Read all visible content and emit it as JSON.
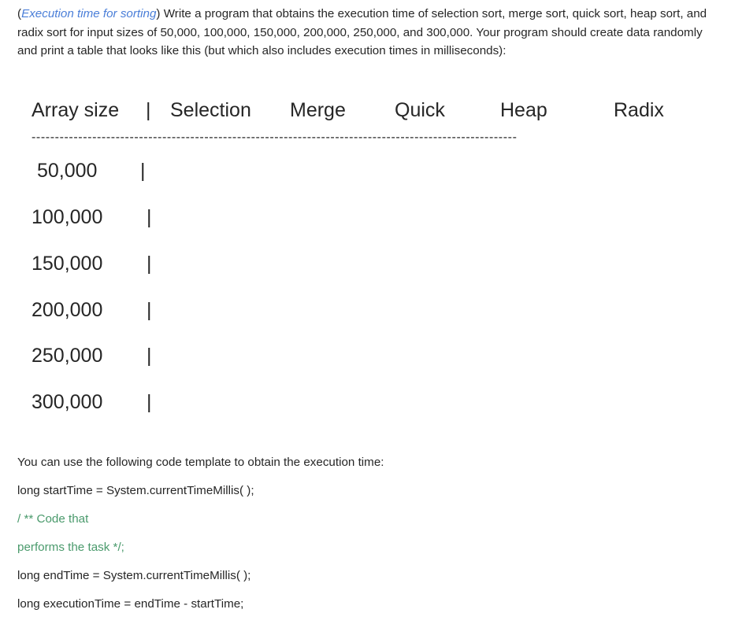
{
  "intro": {
    "italic": "Execution time for sorting",
    "open_paren": "(",
    "rest": ") Write a program that obtains the execution time of selection sort, merge sort, quick sort, heap sort, and radix sort for input sizes of 50,000, 100,000, 150,000, 200,000, 250,000, and 300,000. Your program should create data randomly and print a table that looks like this (but which also includes execution times in milliseconds):"
  },
  "table": {
    "headers": [
      "Array size",
      "|",
      "Selection",
      "Merge",
      "Quick",
      "Heap",
      "Radix"
    ],
    "separator": "--------------------------------------------------------------------------------------------------------",
    "rows": [
      "50,000",
      "100,000",
      "150,000",
      "200,000",
      "250,000",
      "300,000"
    ],
    "bar": "|"
  },
  "code": {
    "intro": "You can use the following code template to obtain the execution time:",
    "line1": "long startTime = System.currentTimeMillis( );",
    "comment1": "/ ** Code that",
    "comment2": "performs the task */;",
    "line2": "long endTime = System.currentTimeMillis( );",
    "line3": "long executionTime = endTime - startTime;"
  },
  "colors": {
    "link": "#4a7ed8",
    "comment": "#4a9a6c",
    "text": "#262626"
  }
}
